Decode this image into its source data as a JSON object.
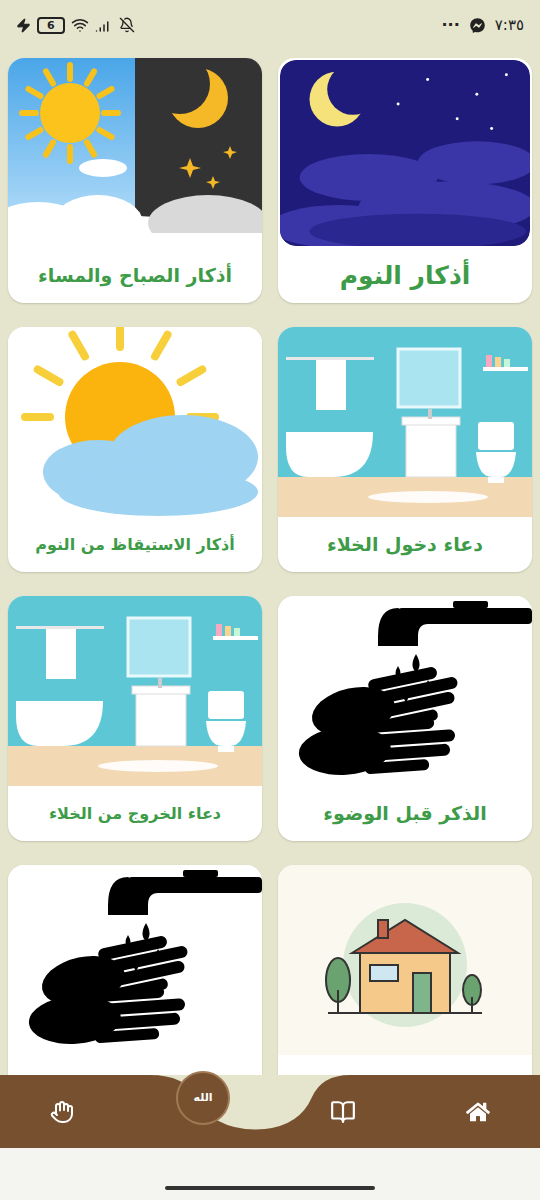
{
  "status_bar": {
    "time": "٧:٣٥",
    "battery": "6",
    "more": "···"
  },
  "cards": [
    {
      "title": "أذكار النوم",
      "kind": "night"
    },
    {
      "title": "أذكار الصباح والمساء",
      "kind": "day-night"
    },
    {
      "title": "دعاء دخول الخلاء",
      "kind": "bathroom"
    },
    {
      "title": "أذكار الاستيقاظ من النوم",
      "kind": "sunrise"
    },
    {
      "title": "الذكر قبل الوضوء",
      "kind": "washing"
    },
    {
      "title": "دعاء الخروج من الخلاء",
      "kind": "bathroom"
    },
    {
      "kind": "house"
    },
    {
      "kind": "washing"
    }
  ],
  "bottom_nav": {
    "emblem": "الله"
  }
}
